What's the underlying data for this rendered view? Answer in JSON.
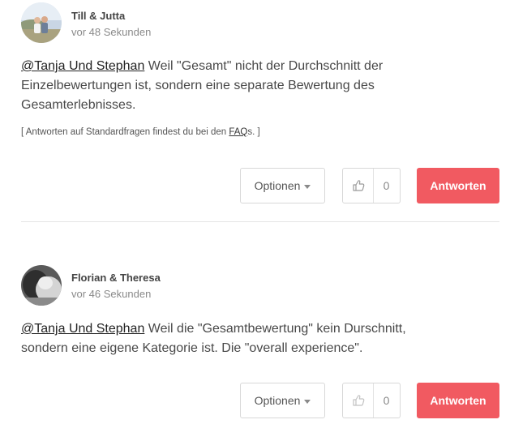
{
  "comments": [
    {
      "author": "Till & Jutta",
      "time": "vor 48 Sekunden",
      "mention": "@Tanja Und Stephan",
      "text": " Weil \"Gesamt\" nicht der Durchschnitt der Einzelbewertungen ist, sondern eine separate Bewertung des Gesamterlebnisses.",
      "faq_prefix": "[ Antworten auf Standardfragen findest du bei den ",
      "faq_link": "FAQ",
      "faq_suffix": "s. ]",
      "options_label": "Optionen",
      "like_count": "0",
      "reply_label": "Antworten",
      "avatar_icon": "couple-photo"
    },
    {
      "author": "Florian & Theresa",
      "time": "vor 46 Sekunden",
      "mention": "@Tanja Und Stephan",
      "text": " Weil die \"Gesamtbewertung\" kein Durschnitt, sondern eine eigene Kategorie ist. Die \"overall experience\".",
      "options_label": "Optionen",
      "like_count": "0",
      "reply_label": "Antworten",
      "avatar_icon": "bw-portrait-photo"
    }
  ],
  "colors": {
    "reply_button": "#f15a61",
    "border": "#d8d8d8",
    "muted_text": "#8a8a8a"
  }
}
